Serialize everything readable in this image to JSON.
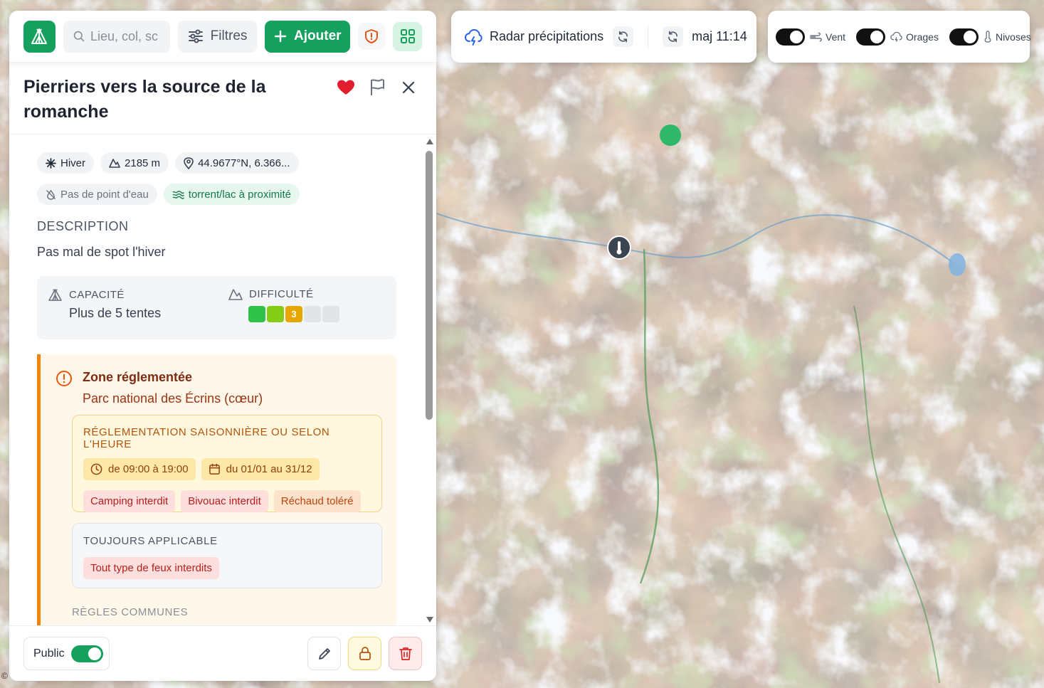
{
  "search": {
    "placeholder": "Lieu, col, sc"
  },
  "toolbar": {
    "filters_label": "Filtres",
    "add_label": "Ajouter"
  },
  "spot": {
    "title": "Pierriers vers la source de la romanche",
    "season": "Hiver",
    "altitude": "2185 m",
    "coords": "44.9677°N, 6.366...",
    "water_none": "Pas de point d'eau",
    "water_near": "torrent/lac à proximité",
    "description_label": "DESCRIPTION",
    "description": "Pas mal de spot l'hiver",
    "capacity_label": "CAPACITÉ",
    "capacity_value": "Plus de 5 tentes",
    "difficulty_label": "DIFFICULTÉ",
    "difficulty_level": 3,
    "difficulty_max": 5,
    "difficulty_text": "3"
  },
  "zone": {
    "title": "Zone réglementée",
    "subtitle": "Parc national des Écrins (cœur)",
    "seasonal_title": "RÉGLEMENTATION SAISONNIÈRE OU SELON L'HEURE",
    "time_range": "de 09:00 à 19:00",
    "date_range": "du 01/01 au 31/12",
    "rule_camping": "Camping interdit",
    "rule_bivouac": "Bivouac interdit",
    "rule_rechaud": "Réchaud toléré",
    "always_title": "TOUJOURS APPLICABLE",
    "rule_fire": "Tout type de feux interdits",
    "common_title": "RÈGLES COMMUNES"
  },
  "footer": {
    "public_label": "Public",
    "public_on": true
  },
  "radar": {
    "label": "Radar précipitations",
    "update": "maj 11:14"
  },
  "layers": {
    "wind": "Vent",
    "storms": "Orages",
    "snow": "Nivoses"
  },
  "colors": {
    "brand": "#16a05d",
    "diff_1": "#2fc24b",
    "diff_2": "#84cc16",
    "diff_3": "#e6a800",
    "diff_off": "#e2e4e7",
    "zone_accent": "#f0840c"
  },
  "map": {
    "copyright": "©"
  }
}
